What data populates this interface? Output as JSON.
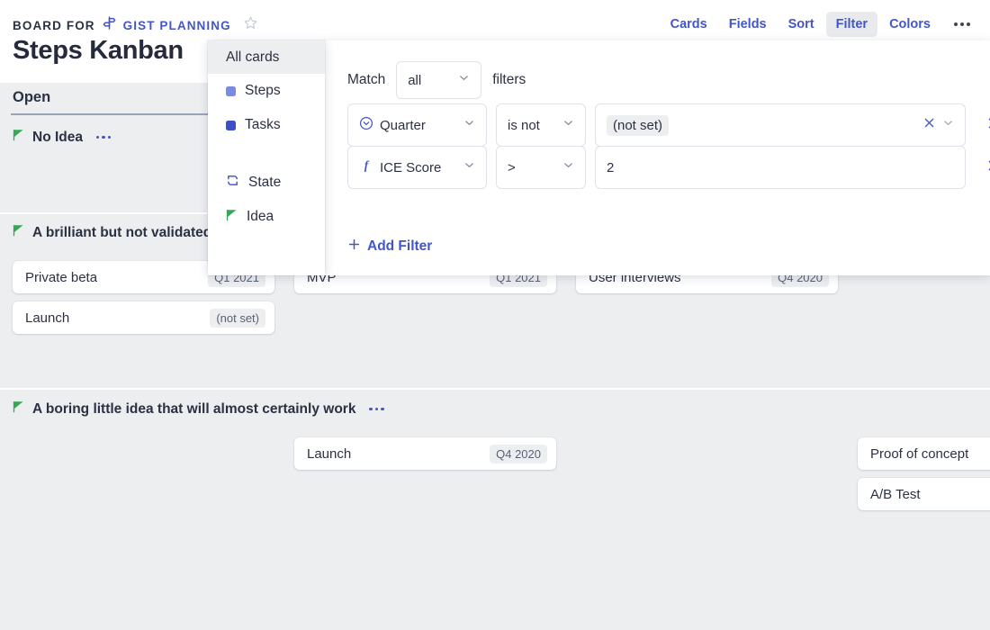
{
  "header": {
    "breadcrumb_prefix": "BOARD FOR",
    "breadcrumb_link": "GIST PLANNING",
    "signpost_icon": "signpost-icon",
    "star_icon": "star-icon",
    "title": "Steps Kanban",
    "toolbar": {
      "cards": "Cards",
      "fields": "Fields",
      "sort": "Sort",
      "filter": "Filter",
      "colors": "Colors",
      "more_icon": "ellipsis-icon",
      "active": "Filter"
    }
  },
  "board": {
    "column_header": "Open",
    "lanes": [
      {
        "title": "No Idea",
        "icon": "green-flag-icon",
        "menu_icon": "ellipsis-icon",
        "cards": []
      },
      {
        "title": "A brilliant but not validated idea",
        "icon": "green-flag-icon",
        "menu_icon": "ellipsis-icon",
        "cards": [
          {
            "title": "Private beta",
            "chip": "Q1 2021"
          },
          {
            "title": "Launch",
            "chip": "(not set)"
          },
          {
            "title": "MVP",
            "chip": "Q1 2021"
          },
          {
            "title": "User interviews",
            "chip": "Q4 2020"
          }
        ]
      },
      {
        "title": "A boring little idea that will almost certainly work",
        "icon": "green-flag-icon",
        "menu_icon": "ellipsis-icon",
        "cards": [
          {
            "title": "Launch",
            "chip": "Q4 2020"
          },
          {
            "title": "Proof of concept",
            "chip": ""
          },
          {
            "title": "A/B Test",
            "chip": ""
          }
        ]
      }
    ]
  },
  "dropdown": {
    "items": [
      {
        "label": "All cards",
        "icon": "",
        "selected": true
      },
      {
        "label": "Steps",
        "icon": "blue-square-icon",
        "color": "#7b8ce0",
        "selected": false
      },
      {
        "label": "Tasks",
        "icon": "dark-blue-square-icon",
        "color": "#3d4fc4",
        "selected": false
      },
      {
        "label": "State",
        "icon": "state-cycle-icon",
        "selected": false
      },
      {
        "label": "Idea",
        "icon": "green-flag-icon",
        "selected": false
      }
    ]
  },
  "filter_panel": {
    "match_prefix": "Match",
    "match_value": "all",
    "match_suffix": "filters",
    "rows": [
      {
        "field": "Quarter",
        "field_icon": "circle-chevron-icon",
        "operator": "is not",
        "value": "(not set)",
        "value_is_token": true,
        "clear_icon": "clear-x-icon",
        "chevron_icon": "chevron-down-icon",
        "remove_icon": "remove-x-icon"
      },
      {
        "field": "ICE Score",
        "field_icon": "function-f-icon",
        "operator": ">",
        "value": "2",
        "value_is_token": false,
        "clear_icon": "",
        "chevron_icon": "",
        "remove_icon": "remove-x-icon"
      }
    ],
    "add_filter_label": "Add Filter",
    "add_filter_icon": "plus-icon"
  },
  "colors": {
    "accent_blue": "#4356c8",
    "board_bg": "#eceef0",
    "text_dark": "#2c3142",
    "flag_green": "#34a853",
    "chip_bg": "#eceef0"
  }
}
